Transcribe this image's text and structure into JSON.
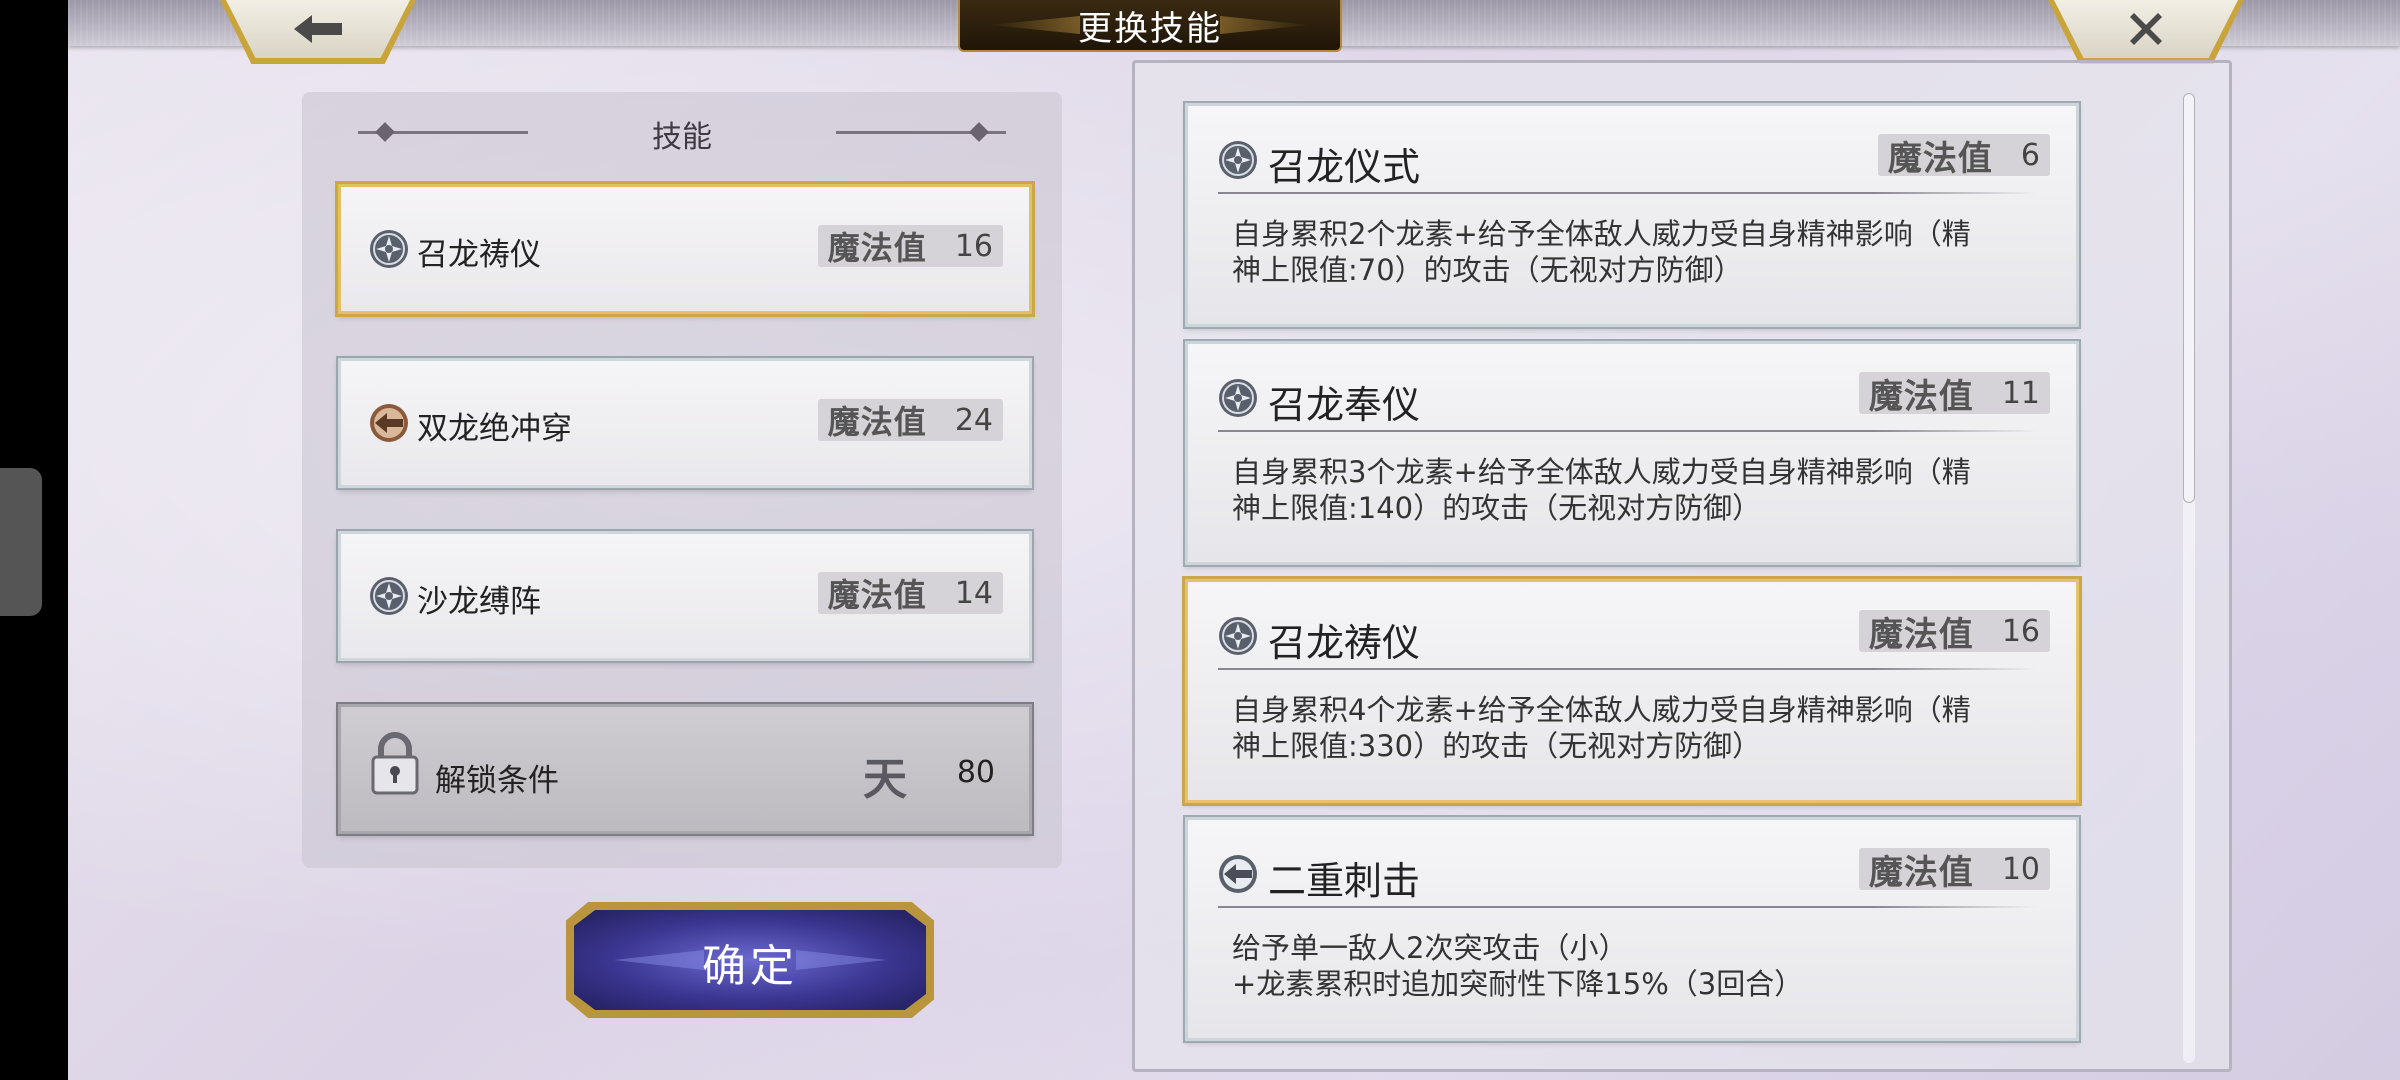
{
  "header": {
    "title": "更换技能",
    "back_icon": "arrow-left-icon",
    "close_icon": "close-icon"
  },
  "equipped": {
    "heading": "技能",
    "slots": [
      {
        "icon": "magic-circle-icon",
        "name": "召龙祷仪",
        "mp_label": "魔法值",
        "mp": "16",
        "selected": true
      },
      {
        "icon": "pierce-icon",
        "name": "双龙绝冲穿",
        "mp_label": "魔法值",
        "mp": "24",
        "selected": false
      },
      {
        "icon": "magic-circle-icon",
        "name": "沙龙缚阵",
        "mp_label": "魔法值",
        "mp": "14",
        "selected": false
      }
    ],
    "locked": {
      "icon": "lock-icon",
      "label": "解锁条件",
      "rank": "天",
      "value": "80"
    },
    "confirm_label": "确定"
  },
  "skills": [
    {
      "icon": "magic-circle-icon",
      "name": "召龙仪式",
      "mp_label": "魔法值",
      "mp": "6",
      "desc_line1": "自身累积2个龙素+给予全体敌人威力受自身精神影响（精",
      "desc_line2": "神上限值:70）的攻击（无视对方防御）",
      "selected": false
    },
    {
      "icon": "magic-circle-icon",
      "name": "召龙奉仪",
      "mp_label": "魔法值",
      "mp": "11",
      "desc_line1": "自身累积3个龙素+给予全体敌人威力受自身精神影响（精",
      "desc_line2": "神上限值:140）的攻击（无视对方防御）",
      "selected": false
    },
    {
      "icon": "magic-circle-icon",
      "name": "召龙祷仪",
      "mp_label": "魔法值",
      "mp": "16",
      "desc_line1": "自身累积4个龙素+给予全体敌人威力受自身精神影响（精",
      "desc_line2": "神上限值:330）的攻击（无视对方防御）",
      "selected": true
    },
    {
      "icon": "pierce-icon",
      "name": "二重刺击",
      "mp_label": "魔法值",
      "mp": "10",
      "desc_line1": "给予单一敌人2次突攻击（小）",
      "desc_line2": "+龙素累积时追加突耐性下降15%（3回合）",
      "selected": false
    }
  ],
  "colors": {
    "selected_border": "#c9a848",
    "confirm_button": "#3b3691",
    "title_plate": "#1f1508"
  }
}
